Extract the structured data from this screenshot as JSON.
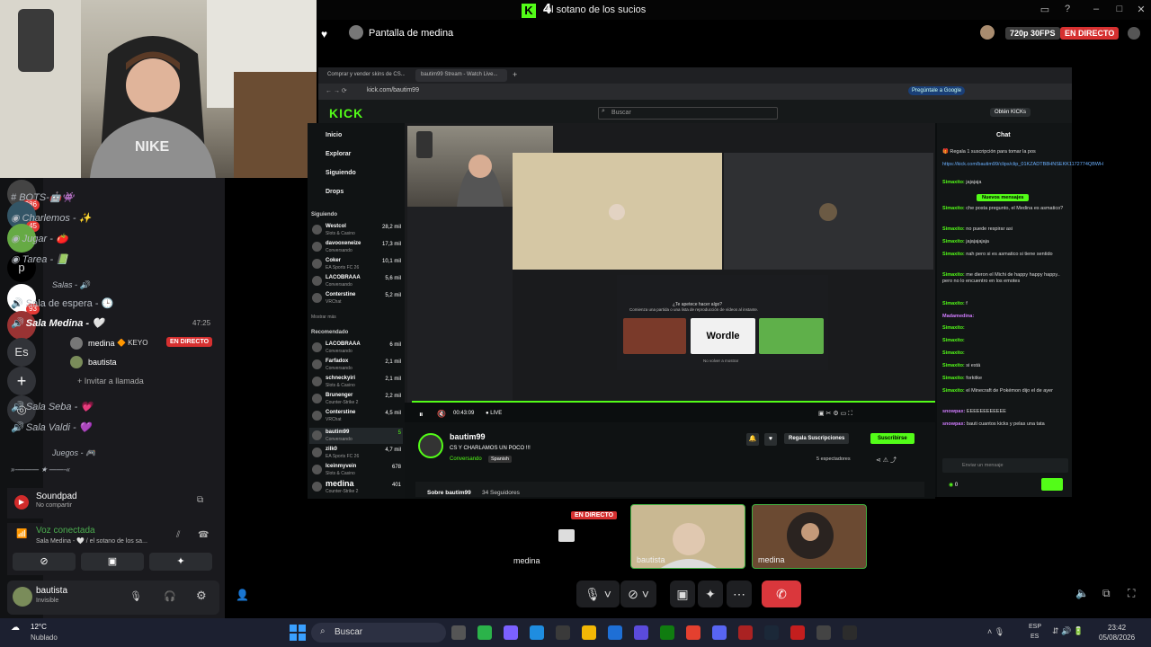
{
  "overlay": {
    "channel_prefix": "4",
    "channel_title": "el sotano de los sucios"
  },
  "stream": {
    "title": "Pantalla de medina",
    "quality": "720p 30FPS",
    "live": "EN DIRECTO"
  },
  "browser": {
    "tabs": [
      "Comprar y vender skins de CS...",
      "bautim99 Stream - Watch Live..."
    ],
    "url": "kick.com/bautim99",
    "ask_google": "Pregúntale a Google",
    "search_placeholder": "Buscar",
    "get_kicks": "Obtén KICKs",
    "logo": "KICK"
  },
  "kick_nav": [
    "Inicio",
    "Explorar",
    "Siguiendo",
    "Drops"
  ],
  "following_title": "Siguiendo",
  "following": [
    {
      "name": "Westcol",
      "cat": "Slots & Casino",
      "views": "28,2 mil"
    },
    {
      "name": "davooxeneize",
      "cat": "Conversando",
      "views": "17,3 mil"
    },
    {
      "name": "Coker",
      "cat": "EA Sports FC 26",
      "views": "10,1 mil"
    },
    {
      "name": "LACOBRAAA",
      "cat": "Conversando",
      "views": "5,6 mil"
    },
    {
      "name": "Conterstine",
      "cat": "VRChat",
      "views": "5,2 mil"
    }
  ],
  "show_more": "Mostrar más",
  "recommended_title": "Recomendado",
  "recommended": [
    {
      "name": "LACOBRAAA",
      "cat": "Conversando",
      "views": "6 mil"
    },
    {
      "name": "Farfadox",
      "cat": "Conversando",
      "views": "2,1 mil"
    },
    {
      "name": "schneckyiri",
      "cat": "Slots & Casino",
      "views": "2,1 mil"
    },
    {
      "name": "Brunenger",
      "cat": "Counter-Strike 2",
      "views": "2,2 mil"
    },
    {
      "name": "Conterstine",
      "cat": "VRChat",
      "views": "4,5 mil"
    },
    {
      "name": "bautim99",
      "cat": "Conversando",
      "views": "5"
    },
    {
      "name": "zilk0",
      "cat": "EA Sports FC 26",
      "views": "4,7 mil"
    },
    {
      "name": "Iceinmyvein",
      "cat": "Slots & Casino",
      "views": "678"
    },
    {
      "name": "medina",
      "cat": "Counter-Strike 2",
      "views": "401"
    }
  ],
  "player": {
    "time": "00:43:09",
    "live": "LIVE",
    "sub_gift": "Regala Suscripciones",
    "subscribe": "Suscribirse",
    "activity_title": "¿Te apetece hacer algo?",
    "activity_sub": "Comienza una partida o una lista de reproducción de vídeos al instante.",
    "activity_wordle": "Wordle",
    "activity_toggle": "No volver a mostrar"
  },
  "channel": {
    "name": "bautim99",
    "title": "CS Y CHARLAMOS UN POCO !!!",
    "category": "Conversando",
    "lang": "Spanish",
    "viewers": "5 espectadores",
    "about": "Sobre bautim99",
    "followers": "34 Seguidores"
  },
  "chat": {
    "title": "Chat",
    "gift": "Regala 1 suscripción para tomar la pos",
    "link": "https://kick.com/bautim99/clips/clip_01KZADTB8HNSEKK1172774QBWH",
    "new_messages": "Nuevos mensajes",
    "input_placeholder": "Enviar un mensaje",
    "count": "0",
    "messages": [
      {
        "user": "Simaxito:",
        "text": "jajajaja",
        "color": "u"
      },
      {
        "user": "Simaxito:",
        "text": "che posta pregunto, el Medina es asmatico?",
        "color": "u"
      },
      {
        "user": "Simaxito:",
        "text": "no puede respirar asi",
        "color": "u"
      },
      {
        "user": "Simaxito:",
        "text": "jajajajajaja",
        "color": "u"
      },
      {
        "user": "Simaxito:",
        "text": "nah pero si es asmatico si tiene sentido",
        "color": "u"
      },
      {
        "user": "Simaxito:",
        "text": "me dieron el Michi de happy happy happy.. pero no lo encuentro en los emotes",
        "color": "u"
      },
      {
        "user": "Simaxito:",
        "text": "f",
        "color": "u"
      },
      {
        "user": "Madamedina:",
        "text": "",
        "color": "p"
      },
      {
        "user": "Simaxito:",
        "text": "",
        "color": "u"
      },
      {
        "user": "Simaxito:",
        "text": "",
        "color": "u"
      },
      {
        "user": "Simaxito:",
        "text": "",
        "color": "u"
      },
      {
        "user": "Simaxito:",
        "text": "si está",
        "color": "u"
      },
      {
        "user": "Simaxito:",
        "text": "forkitke",
        "color": "u"
      },
      {
        "user": "Simaxito:",
        "text": "el Minecraft de Pokémon dijo el de ayer",
        "color": "u"
      },
      {
        "user": "snowpax:",
        "text": "EEEEEEEEEEEE",
        "color": "p"
      },
      {
        "user": "snowpax:",
        "text": "bauti cuantos kicks y pelas una tata",
        "color": "p"
      }
    ]
  },
  "discord": {
    "channels": [
      {
        "label": "BOTS-🤖👾",
        "type": "text"
      },
      {
        "label": "Charlemos - ✨",
        "type": "text"
      },
      {
        "label": "Jugar - 🍅",
        "type": "text"
      },
      {
        "label": "Tarea - 📗",
        "type": "text"
      }
    ],
    "category_salas": "Salas - 🔊",
    "waiting": "Sala de espera - 🕒",
    "sala_medina": "Sala Medina - 🤍",
    "sala_medina_time": "47:25",
    "member1": "medina",
    "member1_tag": "🔶 KEYO",
    "member1_live": "EN DIRECTO",
    "member2": "bautista",
    "invite": "Invitar a llamada",
    "sala_seba": "Sala Seba - 💗",
    "sala_valdi": "Sala Valdi - 💜",
    "category_juegos": "Juegos - 🎮",
    "games_line": "»-——— ★ ——-«",
    "servers": [
      "286",
      "45",
      "p",
      "93",
      "Es"
    ],
    "soundpad": "Soundpad",
    "soundpad_sub": "No compartir",
    "voice": "Voz conectada",
    "voice_sub": "Sala Medina - 🤍 / el sotano de los sa...",
    "user": "bautista",
    "user_status": "Invisible"
  },
  "call": {
    "card1": "medina",
    "card2": "bautista",
    "card3": "medina",
    "live": "EN DIRECTO"
  },
  "taskbar": {
    "weather": "12°C",
    "weather_sub": "Nublado",
    "search": "Buscar",
    "lang": "ESP",
    "lang2": "ES",
    "time": "23:42",
    "date": "05/08/2026"
  },
  "colors": {
    "kick_green": "#53fc18",
    "live_red": "#d63030",
    "discord_bg": "#1a1a1e"
  }
}
